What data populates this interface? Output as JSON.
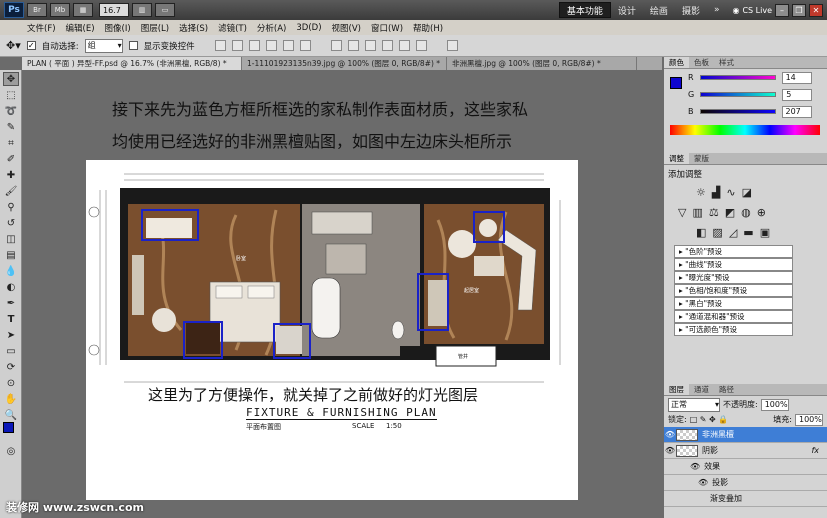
{
  "app": {
    "logo": "Ps",
    "zoom": "16.7",
    "workspaces": [
      "基本功能",
      "设计",
      "绘画",
      "摄影"
    ],
    "active_workspace": "基本功能",
    "more": "»",
    "cs_live": "CS Live"
  },
  "menu": [
    "文件(F)",
    "编辑(E)",
    "图像(I)",
    "图层(L)",
    "选择(S)",
    "滤镜(T)",
    "分析(A)",
    "3D(D)",
    "视图(V)",
    "窗口(W)",
    "帮助(H)"
  ],
  "options": {
    "auto_select_label": "自动选择:",
    "auto_select_value": "组",
    "show_transform_label": "显示变换控件"
  },
  "tabs": [
    "PLAN ( 平面 ) 异型-FF.psd @ 16.7% (非洲黑檀, RGB/8) *",
    "1-11101923135n39.jpg @ 100% (图层 0, RGB/8#) *",
    "非洲黑檀.jpg @ 100% (图层 0, RGB/8#) *"
  ],
  "canvas": {
    "instruction_line1": "接下来先为蓝色方框所框选的家私制作表面材质，这些家私",
    "instruction_line2": "均使用已经选好的非洲黑檀贴图，如图中左边床头柜所示",
    "note": "这里为了方便操作，就关掉了之前做好的灯光图层",
    "plan_title": "FIXTURE & FURNISHING PLAN",
    "plan_subtitle": "平面布置图",
    "scale_label": "SCALE",
    "scale_value": "1:50"
  },
  "color_panel": {
    "tabs": [
      "颜色",
      "色板",
      "样式"
    ],
    "r_label": "R",
    "g_label": "G",
    "b_label": "B",
    "r": "14",
    "g": "5",
    "b": "207",
    "fg_color": "#0e05cf"
  },
  "adjust_panel": {
    "tabs": [
      "调整",
      "蒙版"
    ],
    "title": "添加调整",
    "presets": [
      "\"色阶\"预设",
      "\"曲线\"预设",
      "\"曝光度\"预设",
      "\"色相/饱和度\"预设",
      "\"黑白\"预设",
      "\"通道混和器\"预设",
      "\"可选颜色\"预设"
    ]
  },
  "layers_panel": {
    "tabs": [
      "图层",
      "通道",
      "路径"
    ],
    "blend_mode": "正常",
    "opacity_label": "不透明度:",
    "opacity": "100%",
    "lock_label": "锁定:",
    "fill_label": "填充:",
    "fill": "100%",
    "layers": [
      {
        "name": "非洲黑檀",
        "selected": true
      },
      {
        "name": "阴影",
        "selected": false,
        "fx": "fx"
      }
    ],
    "effects_label": "效果",
    "effect_items": [
      "投影",
      "渐变叠加"
    ]
  },
  "watermark": "装修网 www.zswcn.com"
}
